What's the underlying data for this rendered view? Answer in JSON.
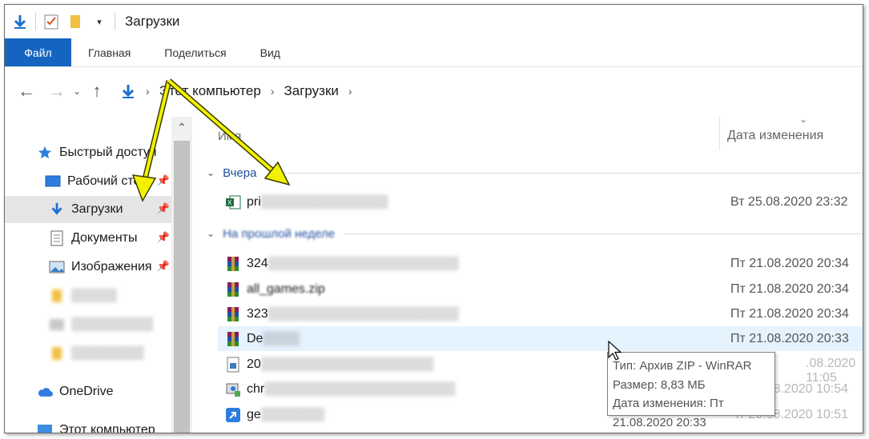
{
  "window": {
    "title": "Загрузки"
  },
  "ribbon": {
    "tabs": [
      "Файл",
      "Главная",
      "Поделиться",
      "Вид"
    ]
  },
  "address": {
    "crumbs": [
      "Этот компьютер",
      "Загрузки"
    ]
  },
  "sidebar": {
    "items": [
      {
        "label": "Быстрый доступ",
        "icon": "star-icon"
      },
      {
        "label": "Рабочий стол",
        "icon": "desktop-icon"
      },
      {
        "label": "Загрузки",
        "icon": "download-icon"
      },
      {
        "label": "Документы",
        "icon": "document-icon"
      },
      {
        "label": "Изображения",
        "icon": "pictures-icon"
      },
      {
        "label": "OneDrive",
        "icon": "cloud-icon"
      },
      {
        "label": "Этот компьютер",
        "icon": "computer-icon"
      }
    ]
  },
  "columns": {
    "name": "Имя",
    "date": "Дата изменения"
  },
  "groups": {
    "yesterday": "Вчера",
    "last_week": "На прошлой неделе"
  },
  "files": [
    {
      "name": "pri",
      "date": "Вт 25.08.2020 23:32",
      "icon": "excel-icon"
    },
    {
      "name": "324",
      "date": "Пт 21.08.2020 20:34",
      "icon": "winrar-icon"
    },
    {
      "name": "all_games.zip",
      "date": "Пт 21.08.2020 20:34",
      "icon": "winrar-icon"
    },
    {
      "name": "323",
      "date": "Пт 21.08.2020 20:34",
      "icon": "winrar-icon"
    },
    {
      "name": "De",
      "date": "Пт 21.08.2020 20:33",
      "icon": "winrar-icon"
    },
    {
      "name": "20",
      "date": "",
      "icon": "image-file-icon"
    },
    {
      "name": "chr",
      "date": "",
      "icon": "installer-icon"
    },
    {
      "name": "ge",
      "date": "",
      "icon": "shortcut-icon"
    }
  ],
  "tooltip": {
    "type": "Тип: Архив ZIP - WinRAR",
    "size": "Размер: 8,83 МБ",
    "modified": "Дата изменения: Пт 21.08.2020 20:33"
  },
  "colors": {
    "accent": "#1565c0",
    "annotation_arrow": "#f2f200",
    "selected": "#e5e5e5",
    "hover": "#e5f3ff",
    "group_text": "#1f4e9e"
  }
}
